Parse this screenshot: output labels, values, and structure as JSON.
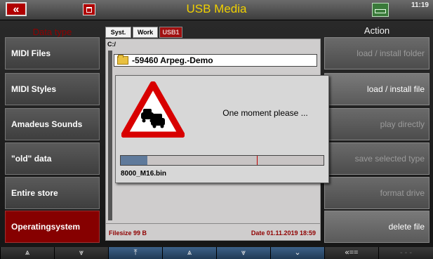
{
  "header": {
    "back_icon": "double-chevron-left-icon",
    "back_label": "«",
    "trash_icon": "trash-icon",
    "title": "USB Media",
    "status_icon": "usb-device-icon",
    "clock": "11:19"
  },
  "left_panel": {
    "header": "Data type",
    "items": [
      {
        "label": "MIDI Files",
        "active": false
      },
      {
        "label": "MIDI Styles",
        "active": false
      },
      {
        "label": "Amadeus Sounds",
        "active": false
      },
      {
        "label": "\"old\" data",
        "active": false
      },
      {
        "label": "Entire store",
        "active": false
      },
      {
        "label": "Operatingsystem",
        "active": true
      }
    ]
  },
  "right_panel": {
    "header": "Action",
    "items": [
      {
        "label": "load  /  install folder",
        "enabled": false
      },
      {
        "label": "load  /  install file",
        "enabled": true
      },
      {
        "label": "play directly",
        "enabled": false
      },
      {
        "label": "save selected type",
        "enabled": false
      },
      {
        "label": "format drive",
        "enabled": false
      },
      {
        "label": "delete file",
        "enabled": true
      }
    ]
  },
  "browser": {
    "tabs": [
      {
        "label": "Syst.",
        "active": false
      },
      {
        "label": "Work",
        "active": false
      },
      {
        "label": "USB1",
        "active": true
      }
    ],
    "path": "C:/",
    "selected_item": "-59460 Arpeg.-Demo",
    "filesize": "Filesize  99 B",
    "date": "Date  01.11.2019   18:59"
  },
  "dialog": {
    "message": "One moment please ...",
    "progress": 0.13,
    "progress_marker": 0.67,
    "filename": "8000_M16.bin",
    "colors": {
      "triangle": "#d80000",
      "fill": "#5f7a9b",
      "marker": "#c00000"
    }
  },
  "navbar": {
    "buttons": [
      {
        "label": "⩓",
        "icon": "double-chevron-up-icon",
        "style": "dark"
      },
      {
        "label": "⩔",
        "icon": "double-chevron-down-icon",
        "style": "dark"
      },
      {
        "label": "⤒",
        "icon": "jump-top-icon",
        "style": "blue"
      },
      {
        "label": "⩓",
        "icon": "double-chevron-up-icon",
        "style": "blue"
      },
      {
        "label": "⩔",
        "icon": "double-chevron-down-icon",
        "style": "blue"
      },
      {
        "label": "⌄",
        "icon": "chevron-down-icon",
        "style": "blue"
      },
      {
        "label": "«==",
        "icon": "back-arrow-icon",
        "style": "dark"
      },
      {
        "label": "- - -",
        "icon": "empty-slot-icon",
        "style": "dim"
      }
    ]
  }
}
